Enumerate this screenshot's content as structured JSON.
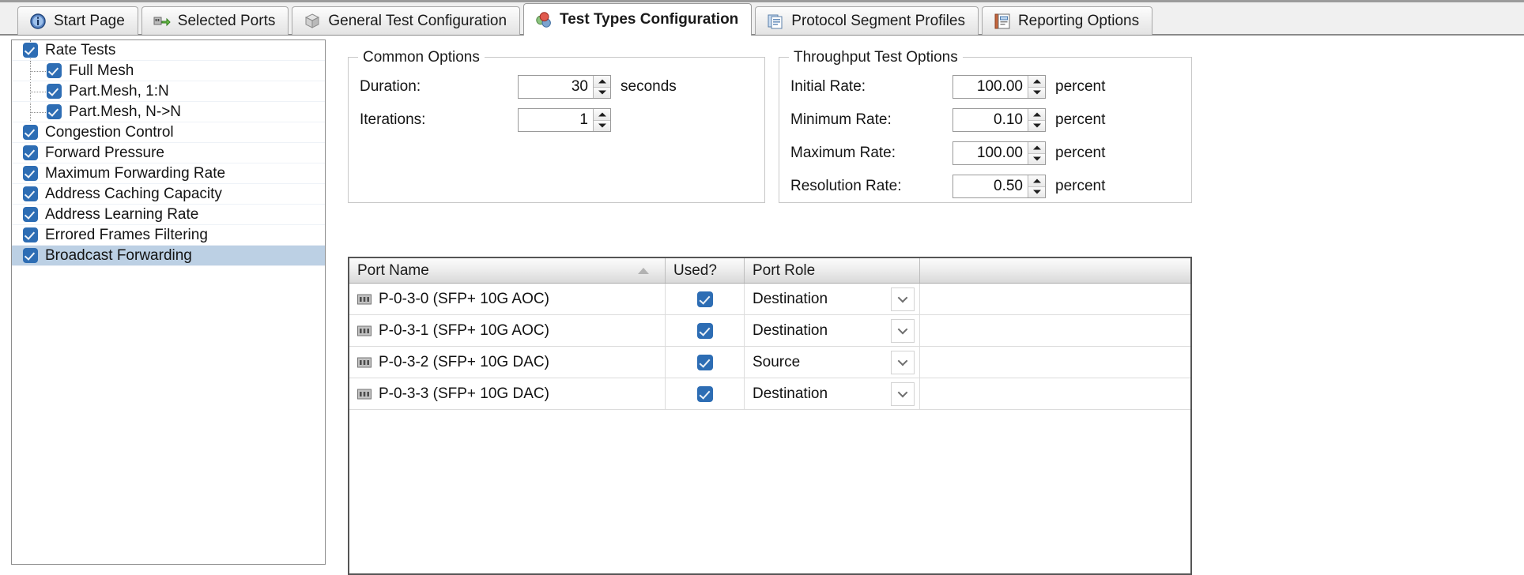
{
  "tabs": [
    {
      "label": "Start Page",
      "icon": "info-icon",
      "active": false
    },
    {
      "label": "Selected Ports",
      "icon": "ports-icon",
      "active": false
    },
    {
      "label": "General Test Configuration",
      "icon": "cube-icon",
      "active": false
    },
    {
      "label": "Test Types Configuration",
      "icon": "spheres-icon",
      "active": true
    },
    {
      "label": "Protocol Segment Profiles",
      "icon": "documents-icon",
      "active": false
    },
    {
      "label": "Reporting Options",
      "icon": "notebook-icon",
      "active": false
    }
  ],
  "tree": {
    "items": [
      {
        "label": "Rate Tests",
        "level": 0,
        "checked": true,
        "selected": false
      },
      {
        "label": "Full Mesh",
        "level": 1,
        "checked": true,
        "selected": false
      },
      {
        "label": "Part.Mesh, 1:N",
        "level": 1,
        "checked": true,
        "selected": false
      },
      {
        "label": "Part.Mesh, N->N",
        "level": 1,
        "checked": true,
        "selected": false
      },
      {
        "label": "Congestion Control",
        "level": 0,
        "checked": true,
        "selected": false
      },
      {
        "label": "Forward Pressure",
        "level": 0,
        "checked": true,
        "selected": false
      },
      {
        "label": "Maximum Forwarding Rate",
        "level": 0,
        "checked": true,
        "selected": false
      },
      {
        "label": "Address Caching Capacity",
        "level": 0,
        "checked": true,
        "selected": false
      },
      {
        "label": "Address Learning Rate",
        "level": 0,
        "checked": true,
        "selected": false
      },
      {
        "label": "Errored Frames Filtering",
        "level": 0,
        "checked": true,
        "selected": false
      },
      {
        "label": "Broadcast Forwarding",
        "level": 0,
        "checked": true,
        "selected": true
      }
    ]
  },
  "common_options": {
    "title": "Common Options",
    "duration": {
      "label": "Duration:",
      "value": "30",
      "unit": "seconds"
    },
    "iterations": {
      "label": "Iterations:",
      "value": "1",
      "unit": ""
    }
  },
  "throughput_options": {
    "title": "Throughput Test Options",
    "initial_rate": {
      "label": "Initial Rate:",
      "value": "100.00",
      "unit": "percent"
    },
    "minimum_rate": {
      "label": "Minimum Rate:",
      "value": "0.10",
      "unit": "percent"
    },
    "maximum_rate": {
      "label": "Maximum Rate:",
      "value": "100.00",
      "unit": "percent"
    },
    "resolution_rate": {
      "label": "Resolution Rate:",
      "value": "0.50",
      "unit": "percent"
    }
  },
  "port_grid": {
    "columns": [
      "Port Name",
      "Used?",
      "Port Role"
    ],
    "sorted_by": "Port Name",
    "sort_direction": "ascending",
    "rows": [
      {
        "port_name": "P-0-3-0 (SFP+ 10G AOC)",
        "used": true,
        "port_role": "Destination"
      },
      {
        "port_name": "P-0-3-1 (SFP+ 10G AOC)",
        "used": true,
        "port_role": "Destination"
      },
      {
        "port_name": "P-0-3-2 (SFP+ 10G DAC)",
        "used": true,
        "port_role": "Source"
      },
      {
        "port_name": "P-0-3-3 (SFP+ 10G DAC)",
        "used": true,
        "port_role": "Destination"
      }
    ]
  },
  "colors": {
    "accent_checkbox": "#2d6db4",
    "selection": "#bcd0e4",
    "tab_active_bg": "#ffffff",
    "panel_bg": "#f0f0f0"
  }
}
